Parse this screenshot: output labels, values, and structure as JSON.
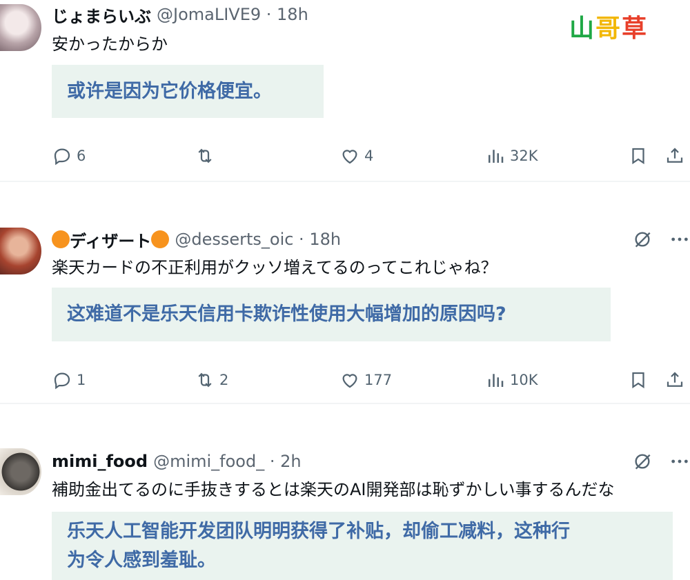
{
  "watermark": [
    "山",
    "哥",
    "草"
  ],
  "tweets": [
    {
      "name": "じょまらいぶ",
      "handle": "@JomaLIVE9 · 18h",
      "text": "安かったからか",
      "translation": "或许是因为它价格便宜。",
      "replies": "6",
      "retweets": "",
      "likes": "4",
      "views": "32K"
    },
    {
      "name": "ディザート",
      "handle": "@desserts_oic · 18h",
      "text": "楽天カードの不正利用がクッソ増えてるのってこれじゃね？",
      "translation": "这难道不是乐天信用卡欺诈性使用大幅增加的原因吗?",
      "replies": "1",
      "retweets": "2",
      "likes": "177",
      "views": "10K"
    },
    {
      "name": "mimi_food",
      "handle": "@mimi_food_ · 2h",
      "text": "補助金出てるのに手抜きするとは楽天のAI開発部は恥ずかしい事するんだな",
      "translation_line1": "乐天人工智能开发团队明明获得了补贴，却偷工减料，这种行",
      "translation_line2": "为令人感到羞耻。"
    }
  ],
  "colors": {
    "translation_bg": "#eaf3ef",
    "translation_text": "#3f6aa6",
    "icon_gray": "#536471",
    "emoji_orange": "#f7931e"
  }
}
